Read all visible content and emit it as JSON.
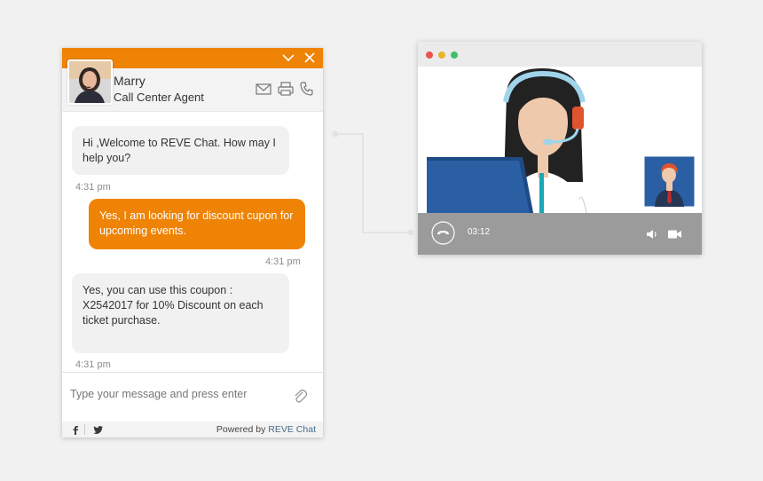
{
  "chat": {
    "header": {
      "minimize_icon": "chevron-down-icon",
      "close_icon": "close-icon"
    },
    "agent": {
      "name": "Marry",
      "role": "Call Center Agent"
    },
    "actions": [
      "mail-icon",
      "print-icon",
      "phone-icon"
    ],
    "messages": [
      {
        "direction": "incoming",
        "text": "Hi ,Welcome to REVE Chat. How may I help you?",
        "time": "4:31 pm"
      },
      {
        "direction": "outgoing",
        "text": "Yes, I am looking for discount cupon for upcoming events.",
        "time": "4:31 pm"
      },
      {
        "direction": "incoming",
        "text": "Yes, you can use this coupon : X2542017 for 10% Discount on each ticket purchase.",
        "time": "4:31 pm"
      }
    ],
    "composer": {
      "placeholder": "Type your message and press enter",
      "attach_icon": "paperclip-icon"
    },
    "footer": {
      "social": [
        "facebook-icon",
        "twitter-icon"
      ],
      "powered_by": "Powered by",
      "brand": "REVE Chat"
    }
  },
  "video_call": {
    "window_controls": [
      "close",
      "minimize",
      "maximize"
    ],
    "timer": "03:12",
    "controls": [
      "end-call-icon",
      "volume-icon",
      "camera-icon"
    ]
  },
  "colors": {
    "accent": "#ef8305",
    "callbar": "#9b9b9b",
    "dot_red": "#e9534f",
    "dot_yellow": "#e7b529",
    "dot_green": "#3fbf6a"
  }
}
